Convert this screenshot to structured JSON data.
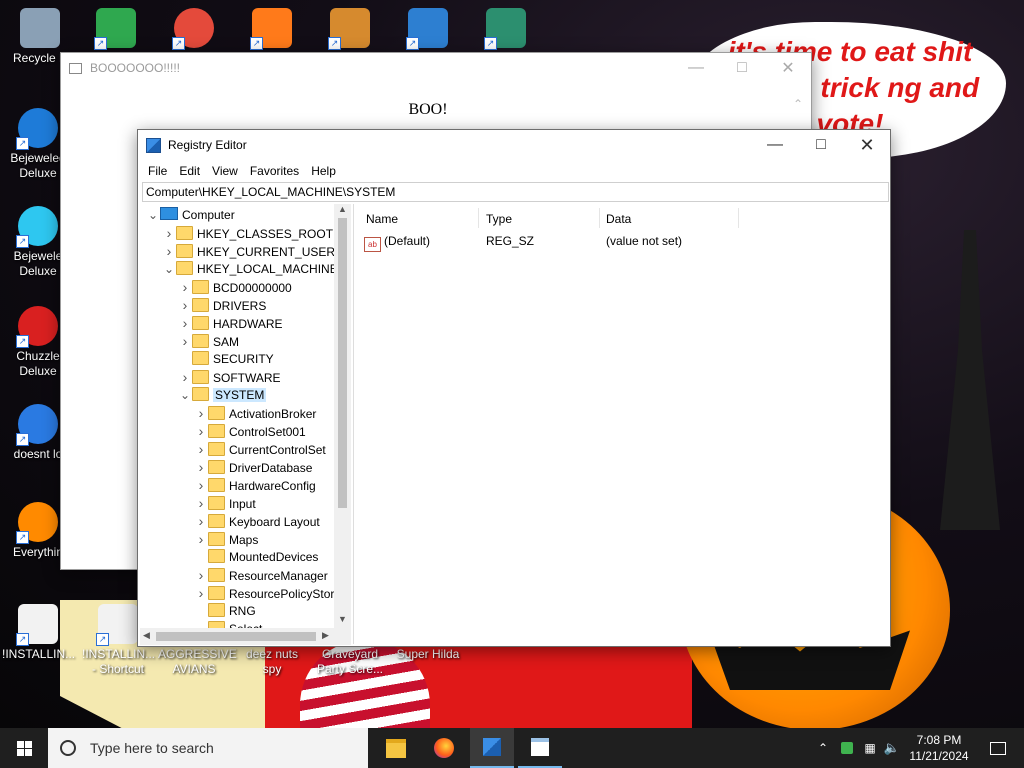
{
  "desktop": {
    "top_icons": [
      {
        "label": "Recycle B",
        "icon": "recycle-bin-icon"
      },
      {
        "label": "",
        "icon": "users-icon"
      },
      {
        "label": "",
        "icon": "chrome-icon"
      },
      {
        "label": "",
        "icon": "p-app-icon"
      },
      {
        "label": "",
        "icon": "folder-app-icon"
      },
      {
        "label": "",
        "icon": "windows-shield-icon"
      },
      {
        "label": "",
        "icon": "character-icon"
      }
    ],
    "left_icons": [
      {
        "label": "Bejeweled Deluxe",
        "icon": "bejeweled-2-icon"
      },
      {
        "label": "Bejewele Deluxe",
        "icon": "bejeweled-gem-icon"
      },
      {
        "label": "Chuzzle Deluxe",
        "icon": "chuzzle-icon"
      },
      {
        "label": "doesnt lo",
        "icon": "thunderbird-icon"
      },
      {
        "label": "Everythin",
        "icon": "everything-search-icon"
      }
    ],
    "bottom_icons": [
      {
        "label": "!INSTALLIN...",
        "icon": "document-icon"
      },
      {
        "label": "!INSTALLIN... - Shortcut",
        "icon": "document-shortcut-icon"
      },
      {
        "label": "AGGRESSIVE AVIANS",
        "icon": "game-icon"
      },
      {
        "label": "deez nuts spy",
        "icon": "game-icon"
      },
      {
        "label": "Graveyard Party Scre...",
        "icon": "game-icon"
      },
      {
        "label": "Super Hilda",
        "icon": "game-icon"
      }
    ],
    "wallpaper_text": "it's time to eat shit and go trick ng and vote!"
  },
  "boo_window": {
    "title": "BOOOOOOO!!!!!",
    "message": "BOO!"
  },
  "registry": {
    "title": "Registry Editor",
    "menu": [
      "File",
      "Edit",
      "View",
      "Favorites",
      "Help"
    ],
    "address": "Computer\\HKEY_LOCAL_MACHINE\\SYSTEM",
    "tree": [
      {
        "label": "Computer",
        "level": 0,
        "chev": "v",
        "icon": "pc"
      },
      {
        "label": "HKEY_CLASSES_ROOT",
        "level": 1,
        "chev": ">"
      },
      {
        "label": "HKEY_CURRENT_USER",
        "level": 1,
        "chev": ">"
      },
      {
        "label": "HKEY_LOCAL_MACHINE",
        "level": 1,
        "chev": "v"
      },
      {
        "label": "BCD00000000",
        "level": 2,
        "chev": ">"
      },
      {
        "label": "DRIVERS",
        "level": 2,
        "chev": ">"
      },
      {
        "label": "HARDWARE",
        "level": 2,
        "chev": ">"
      },
      {
        "label": "SAM",
        "level": 2,
        "chev": ">"
      },
      {
        "label": "SECURITY",
        "level": 2,
        "chev": ""
      },
      {
        "label": "SOFTWARE",
        "level": 2,
        "chev": ">"
      },
      {
        "label": "SYSTEM",
        "level": 2,
        "chev": "v",
        "selected": true
      },
      {
        "label": "ActivationBroker",
        "level": 3,
        "chev": ">"
      },
      {
        "label": "ControlSet001",
        "level": 3,
        "chev": ">"
      },
      {
        "label": "CurrentControlSet",
        "level": 3,
        "chev": ">"
      },
      {
        "label": "DriverDatabase",
        "level": 3,
        "chev": ">"
      },
      {
        "label": "HardwareConfig",
        "level": 3,
        "chev": ">"
      },
      {
        "label": "Input",
        "level": 3,
        "chev": ">"
      },
      {
        "label": "Keyboard Layout",
        "level": 3,
        "chev": ">"
      },
      {
        "label": "Maps",
        "level": 3,
        "chev": ">"
      },
      {
        "label": "MountedDevices",
        "level": 3,
        "chev": ""
      },
      {
        "label": "ResourceManager",
        "level": 3,
        "chev": ">"
      },
      {
        "label": "ResourcePolicyStore",
        "level": 3,
        "chev": ">"
      },
      {
        "label": "RNG",
        "level": 3,
        "chev": ""
      },
      {
        "label": "Select",
        "level": 3,
        "chev": ""
      }
    ],
    "columns": [
      "Name",
      "Type",
      "Data"
    ],
    "values": [
      {
        "name": "(Default)",
        "type": "REG_SZ",
        "data": "(value not set)"
      }
    ]
  },
  "taskbar": {
    "search_placeholder": "Type here to search",
    "apps": [
      "file-explorer-icon",
      "firefox-icon",
      "registry-editor-icon",
      "boo-window-icon"
    ],
    "time": "7:08 PM",
    "date": "11/21/2024"
  }
}
